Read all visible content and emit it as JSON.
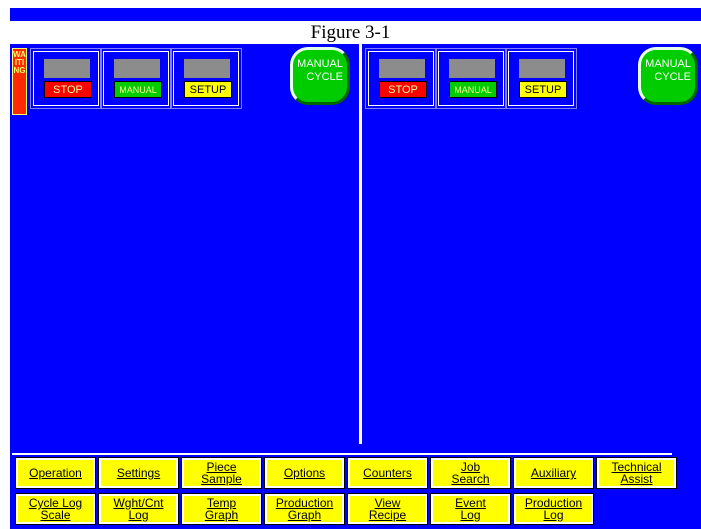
{
  "figure_caption": "Figure 3-1",
  "status_indicator": "WAITING",
  "left_panel": {
    "stop_label": "STOP",
    "manual_label": "MANUAL",
    "setup_label": "SETUP",
    "cycle_button_line1": "MANUAL",
    "cycle_button_line2": "CYCLE"
  },
  "right_panel": {
    "stop_label": "STOP",
    "manual_label": "MANUAL",
    "setup_label": "SETUP",
    "cycle_button_line1": "MANUAL",
    "cycle_button_line2": "CYCLE"
  },
  "nav_row1": [
    {
      "label": "Operation"
    },
    {
      "label": "Settings"
    },
    {
      "label": "Piece\nSample"
    },
    {
      "label": "Options"
    },
    {
      "label": "Counters"
    },
    {
      "label": "Job\nSearch"
    },
    {
      "label": "Auxiliary"
    },
    {
      "label": "Technical\nAssist"
    }
  ],
  "nav_row2": [
    {
      "label": "Cycle Log\nScale"
    },
    {
      "label": "Wght/Cnt\nLog"
    },
    {
      "label": "Temp\nGraph"
    },
    {
      "label": "Production\nGraph"
    },
    {
      "label": "View\nRecipe"
    },
    {
      "label": "Event\nLog"
    },
    {
      "label": "Production\nLog"
    }
  ],
  "colors": {
    "screen_bg": "#0000ff",
    "button_yellow": "#ffff00",
    "stop_red": "#ff0000",
    "manual_green": "#00cc00"
  }
}
